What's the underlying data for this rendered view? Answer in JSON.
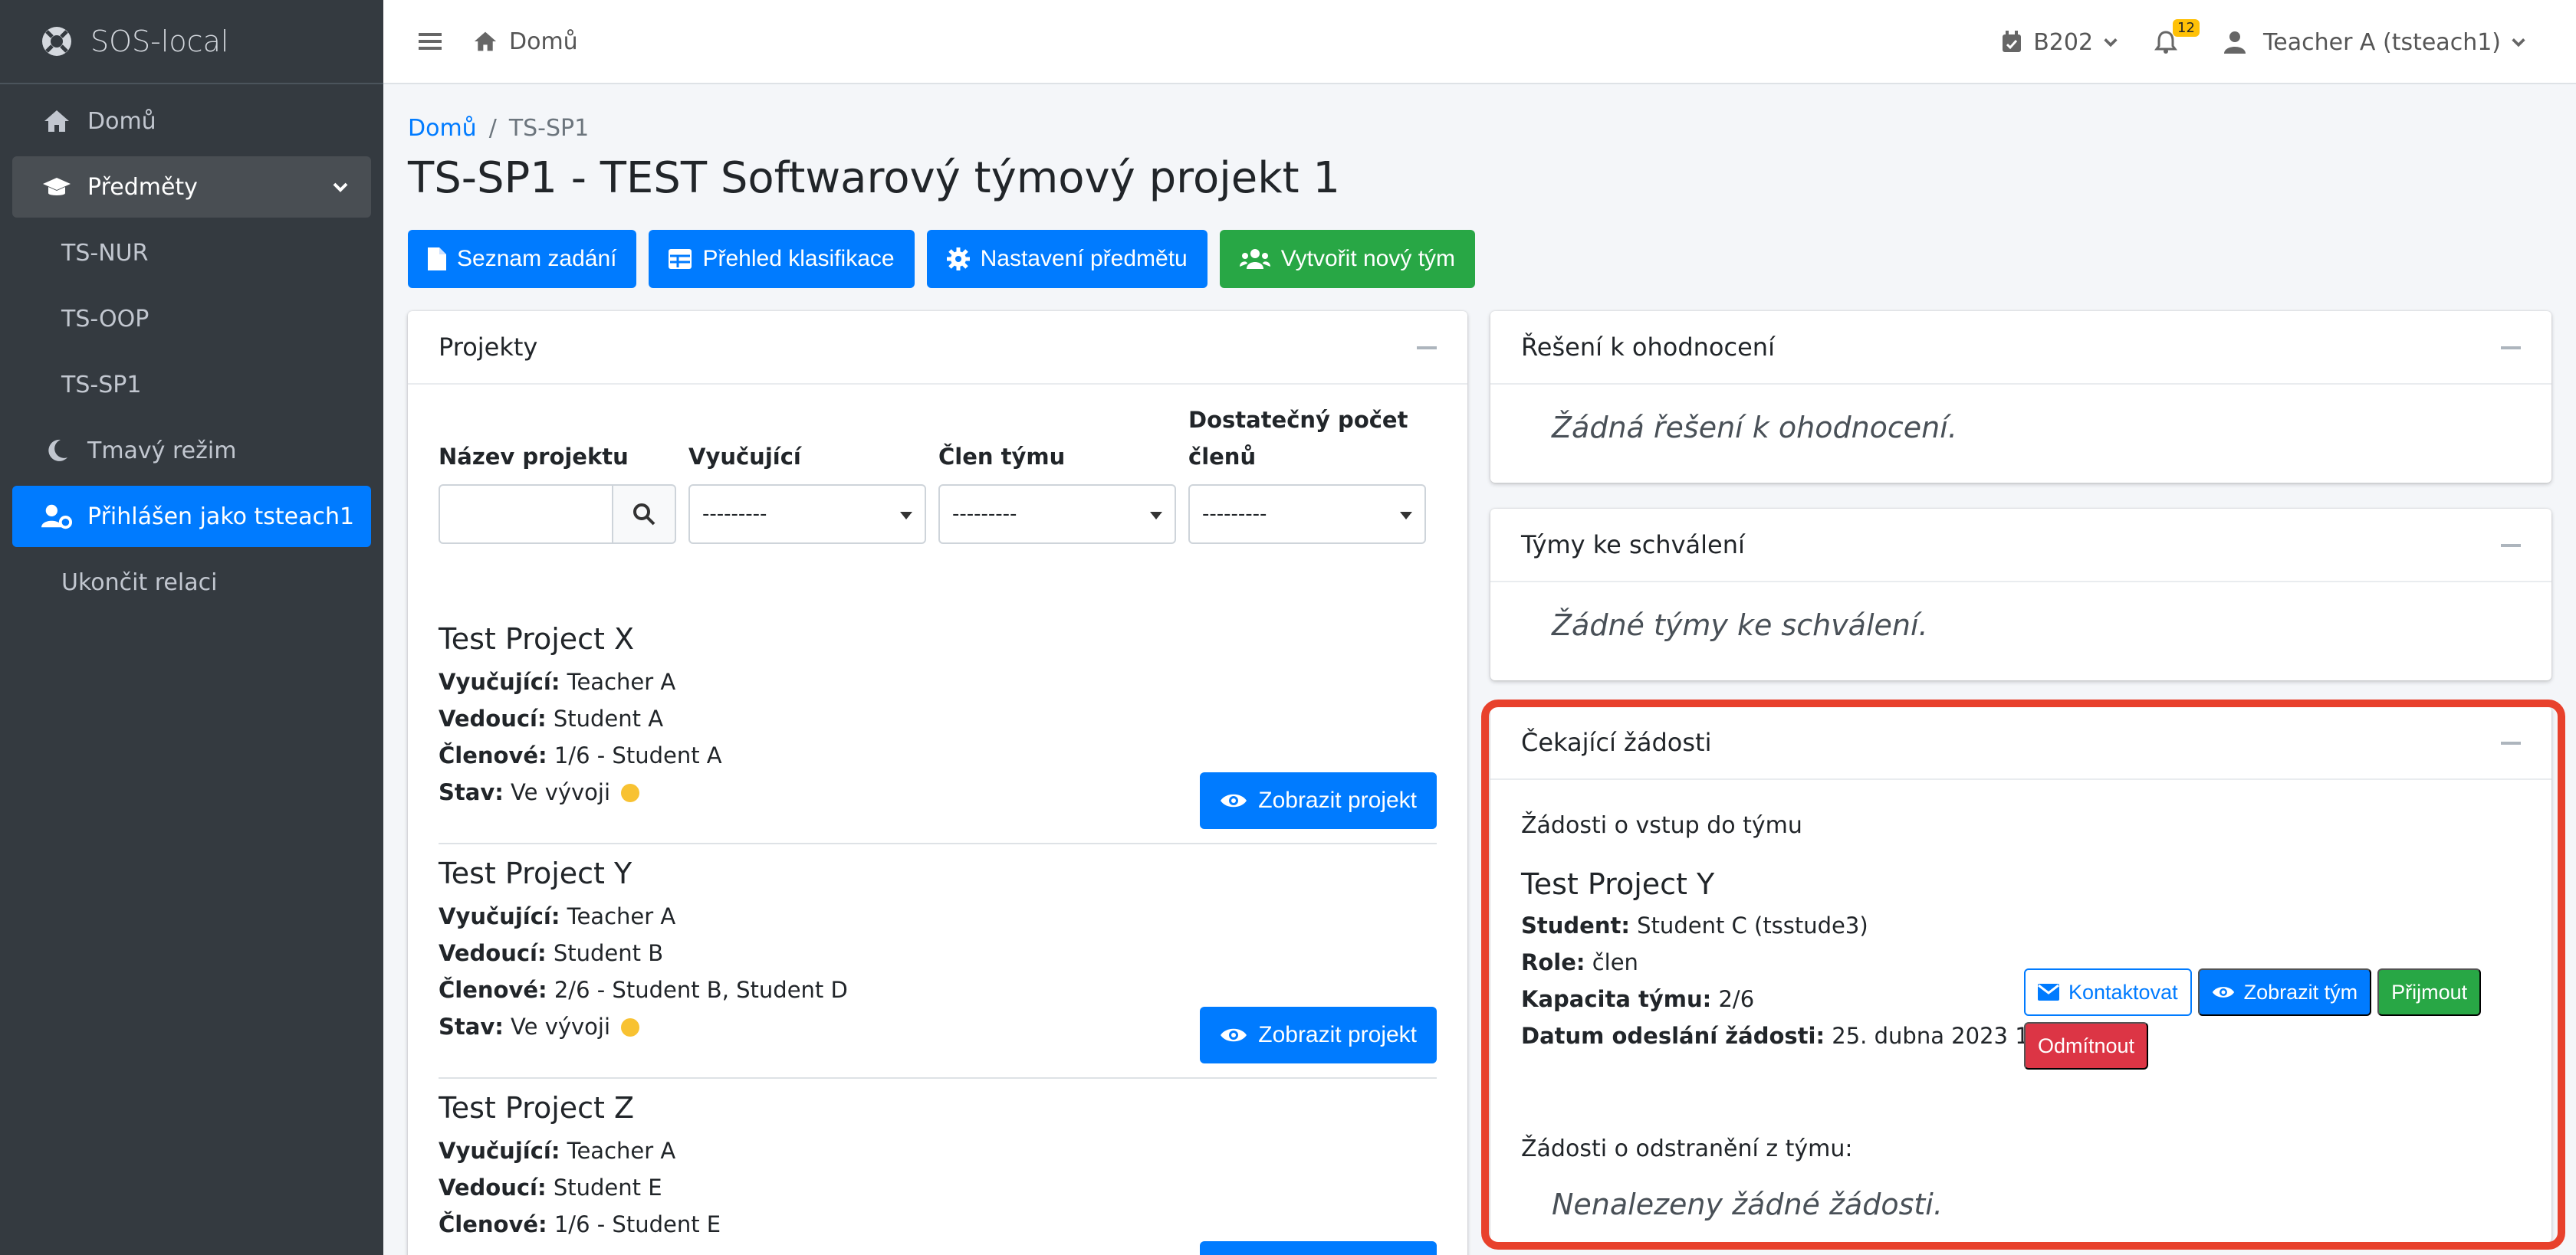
{
  "brand": {
    "name": "SOS-local"
  },
  "sidebar": {
    "items": [
      {
        "label": "Domů"
      },
      {
        "label": "Předměty"
      },
      {
        "label": "TS-NUR"
      },
      {
        "label": "TS-OOP"
      },
      {
        "label": "TS-SP1"
      },
      {
        "label": "Tmavý režim"
      },
      {
        "label": "Přihlášen jako tsteach1"
      },
      {
        "label": "Ukončit relaci"
      }
    ]
  },
  "topbar": {
    "home": "Domů",
    "room": "B202",
    "notifications_count": "12",
    "user": "Teacher A (tsteach1)"
  },
  "breadcrumb": {
    "home": "Domů",
    "current": "TS-SP1"
  },
  "page": {
    "title": "TS-SP1 - TEST Softwarový týmový projekt 1"
  },
  "actions": {
    "assignments": "Seznam zadání",
    "grades": "Přehled klasifikace",
    "settings": "Nastavení předmětu",
    "new_team": "Vytvořit nový tým"
  },
  "projects": {
    "title": "Projekty",
    "filters": {
      "name": "Název projektu",
      "teacher": "Vyučující",
      "member": "Člen týmu",
      "enough_members": "Dostatečný počet členů",
      "select_placeholder": "---------"
    },
    "labels": {
      "teacher": "Vyučující:",
      "leader": "Vedoucí:",
      "members": "Členové:",
      "status": "Stav:"
    },
    "view_label": "Zobrazit projekt",
    "items": [
      {
        "name": "Test Project X",
        "teacher": "Teacher A",
        "leader": "Student A",
        "members": "1/6 - Student A",
        "status": "Ve vývoji"
      },
      {
        "name": "Test Project Y",
        "teacher": "Teacher A",
        "leader": "Student B",
        "members": "2/6 - Student B, Student D",
        "status": "Ve vývoji"
      },
      {
        "name": "Test Project Z",
        "teacher": "Teacher A",
        "leader": "Student E",
        "members": "1/6 - Student E",
        "status": ""
      }
    ]
  },
  "solutions": {
    "title": "Řešení k ohodnocení",
    "empty": "Žádná řešení k ohodnocení."
  },
  "approvals": {
    "title": "Týmy ke schválení",
    "empty": "Žádné týmy ke schválení."
  },
  "requests": {
    "title": "Čekající žádosti",
    "join_heading": "Žádosti o vstup do týmu",
    "project": "Test Project Y",
    "labels": {
      "student": "Student:",
      "role": "Role:",
      "capacity": "Kapacita týmu:",
      "date": "Datum odeslání žádosti:"
    },
    "student": "Student C (tsstude3)",
    "role": "člen",
    "capacity": "2/6",
    "date": "25. dubna 2023 19:23",
    "contact": "Kontaktovat",
    "view_team": "Zobrazit tým",
    "accept": "Přijmout",
    "reject": "Odmítnout",
    "remove_heading": "Žádosti o odstranění z týmu:",
    "remove_empty": "Nenalezeny žádné žádosti."
  },
  "colors": {
    "primary": "#007bff",
    "success": "#28a745",
    "danger": "#dc3545",
    "sidebar": "#343a40",
    "highlight": "#e8412c"
  }
}
